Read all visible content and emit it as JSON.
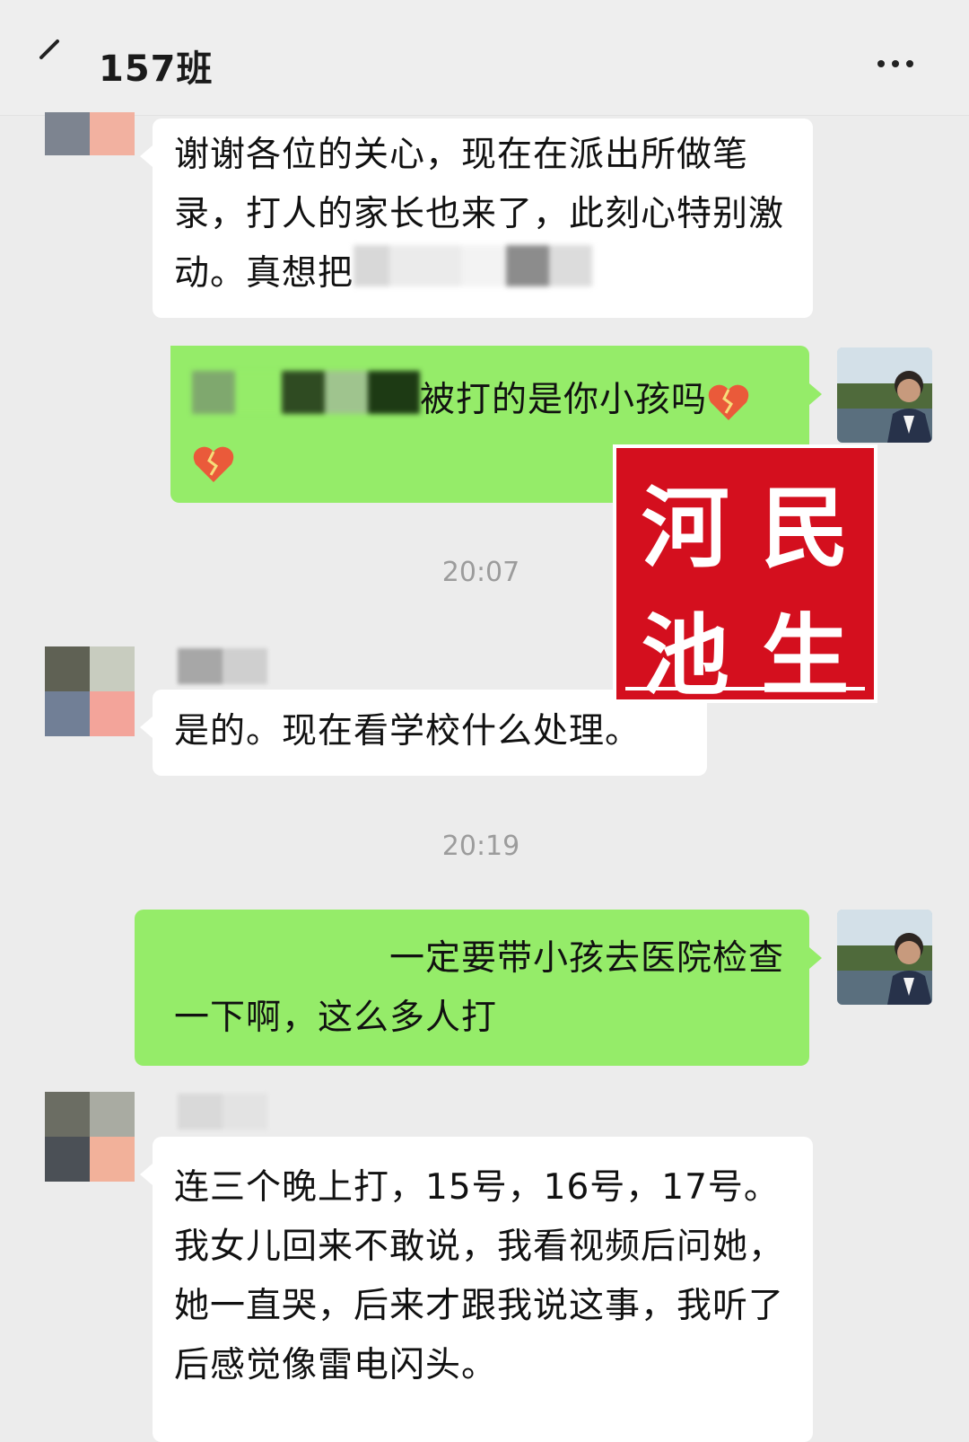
{
  "header": {
    "title": "157班",
    "back_icon": "back-icon",
    "more_icon": "more-icon"
  },
  "messages": [
    {
      "direction": "incoming",
      "text": "谢谢各位的关心，现在在派出所做笔录，打人的家长也来了，此刻心特别激动。真想把"
    },
    {
      "direction": "outgoing",
      "text": "被打的是你小孩吗",
      "emoji": "broken-heart"
    },
    {
      "direction": "incoming",
      "text": "是的。现在看学校什么处理。"
    },
    {
      "direction": "outgoing",
      "text": "一定要带小孩去医院检查一下啊，这么多人打"
    },
    {
      "direction": "incoming",
      "text": "连三个晚上打，15号，16号，17号。我女儿回来不敢说，我看视频后问她，她一直哭，后来才跟我说这事，我听了后感觉像雷电闪头。"
    }
  ],
  "timestamps": [
    "20:07",
    "20:19"
  ],
  "watermark": {
    "chars": [
      "河",
      "民",
      "池",
      "生"
    ],
    "color": "#d40f1e"
  },
  "colors": {
    "outgoing_bubble": "#95ec69",
    "incoming_bubble": "#ffffff",
    "background": "#ececec"
  }
}
